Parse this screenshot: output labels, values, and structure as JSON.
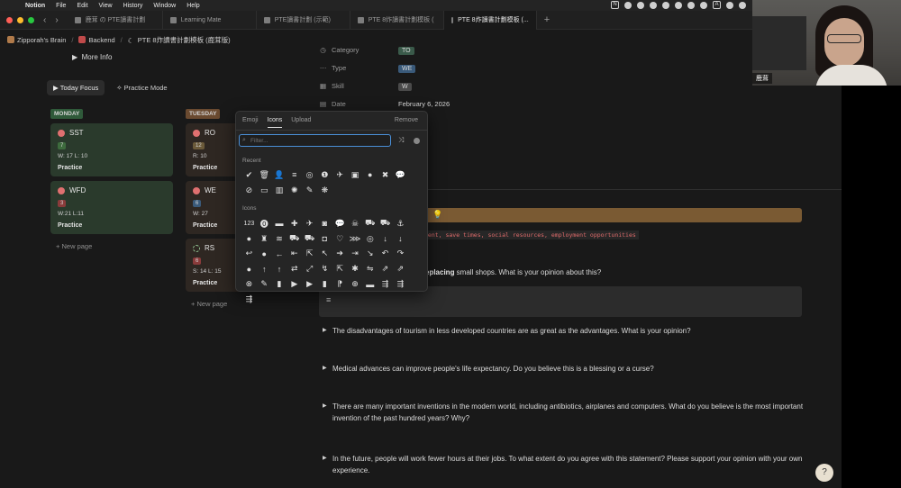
{
  "menubar": {
    "items": [
      "Notion",
      "File",
      "Edit",
      "View",
      "History",
      "Window",
      "Help"
    ],
    "tray": [
      "N",
      "A"
    ]
  },
  "tabs": [
    {
      "label": "鹿茸 の PTE讀書計劃",
      "active": false
    },
    {
      "label": "Learning Mate",
      "active": false
    },
    {
      "label": "PTE讀書計劃 (示範)",
      "active": false
    },
    {
      "label": "PTE 8炸讀書計劃模板 (",
      "active": false
    },
    {
      "label": "PTE 8炸讀書計劃模板 (...",
      "active": true
    }
  ],
  "breadcrumb": [
    "Zipporah's Brain",
    "Backend",
    "PTE 8炸讀書計劃模板 (鹿茸版)"
  ],
  "left": {
    "more_info": "More Info",
    "view_tabs": [
      "Today Focus",
      "Practice Mode"
    ],
    "columns": [
      {
        "header": "MONDAY",
        "header_color": "#2f5a3a",
        "cards": [
          {
            "title": "SST",
            "badge": "7",
            "badge_color": "#3d6b3d",
            "stats": "W: 17 L: 10",
            "action": "Practice",
            "status": "urgent"
          },
          {
            "title": "WFD",
            "badge": "3",
            "badge_color": "#8a3b3b",
            "stats": "W:21 L:11",
            "action": "Practice",
            "status": "urgent"
          }
        ],
        "new_page": "New page"
      },
      {
        "header": "TUESDAY",
        "header_color": "#6a4a30",
        "cards": [
          {
            "title": "RO",
            "badge": "12",
            "badge_color": "#6b5a3a",
            "stats": "R: 10",
            "action": "Practice",
            "status": "urgent"
          },
          {
            "title": "WE",
            "badge": "6",
            "badge_color": "#3a5a7a",
            "stats": "W: 27",
            "action": "Practice",
            "status": "urgent"
          },
          {
            "title": "RS",
            "badge": "6",
            "badge_color": "#8a3b3b",
            "stats": "S: 14 L: 15",
            "action": "Practice",
            "status": "partial"
          }
        ],
        "new_page": "New page"
      }
    ]
  },
  "properties": [
    {
      "icon": "category-icon",
      "glyph": "◷",
      "label": "Category",
      "value": "TO",
      "chip_color": "#3a5a4a"
    },
    {
      "icon": "type-icon",
      "glyph": "⋯",
      "label": "Type",
      "value": "WE",
      "chip_color": "#3a5a7a"
    },
    {
      "icon": "skill-icon",
      "glyph": "▦",
      "label": "Skill",
      "value": "W",
      "chip_color": "#4a4a4a"
    },
    {
      "icon": "date-icon",
      "glyph": "▤",
      "label": "Date",
      "value": "February 6, 2026",
      "chip_color": ""
    }
  ],
  "content": {
    "code_line": "ment, save times, social resources, employment opportunities",
    "first_topic_bold": "eplacing",
    "first_topic_rest": " small shops. What is your opinion about this?",
    "toggles": [
      "The disadvantages of tourism in less developed countries are as great as the advantages. What is your opinion?",
      "Medical advances can improve people's life expectancy. Do you believe this is a blessing or a curse?",
      "There are many important inventions in the modern world, including antibiotics, airplanes and computers. What do you believe is the most important invention of the past hundred years? Why?",
      "In the future, people will work fewer hours at their jobs. To what extent do you agree with this statement? Please support your opinion with your own experience."
    ]
  },
  "picker": {
    "tabs": [
      "Emoji",
      "Icons",
      "Upload"
    ],
    "active_tab": "Icons",
    "remove": "Remove",
    "filter_placeholder": "Filter...",
    "recent_label": "Recent",
    "icons_label": "Icons",
    "recent": [
      "✔",
      "🗑",
      "👤",
      "≡",
      "◎",
      "❶",
      "✈",
      "▣",
      "●",
      "✖",
      "💬",
      "⊘",
      "▭",
      "▥",
      "✺",
      "✎",
      "❋"
    ],
    "icons": [
      "123",
      "⓿",
      "▬",
      "✚",
      "✈",
      "◙",
      "💬",
      "☠",
      "⛟",
      "⛟",
      "⚓",
      "●",
      "♜",
      "≋",
      "⛟",
      "⛟",
      "◘",
      "♡",
      "⋙",
      "◎",
      "↓",
      "↓",
      "↩",
      "●",
      "←",
      "⇤",
      "⇱",
      "↖",
      "➔",
      "⇥",
      "↘",
      "↶",
      "↷",
      "●",
      "↑",
      "↑",
      "⇄",
      "⤢",
      "↯",
      "⇱",
      "✱",
      "⇋",
      "⇗",
      "⇗",
      "⊗",
      "✎",
      "▮",
      "▶",
      "▶",
      "▮",
      "⁋",
      "⊕",
      "▬",
      "⇶",
      "⇶",
      "⇶"
    ]
  },
  "webcam": {
    "name": "鹿茸"
  },
  "help": "?"
}
